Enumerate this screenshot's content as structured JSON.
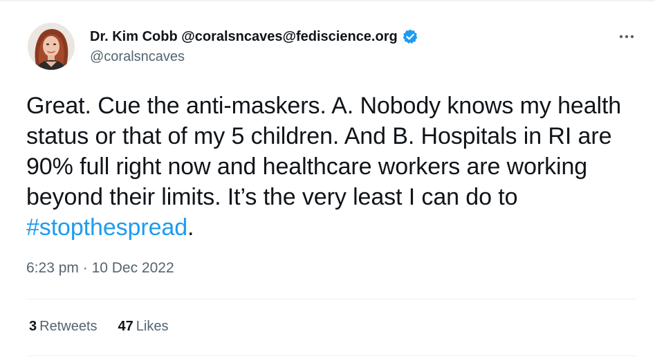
{
  "author": {
    "display_name": "Dr. Kim Cobb @coralsncaves@fediscience.org",
    "handle": "@coralsncaves",
    "verified_icon": "verified-badge-icon",
    "verified_color": "#1d9bf0"
  },
  "tweet": {
    "text_before_hashtag": "Great. Cue the anti-maskers. A. Nobody knows my health status or that of my 5 children. And B. Hospitals in RI are 90% full right now and healthcare workers are working beyond their limits. It’s the very least I can do to ",
    "hashtag": "#stopthespread",
    "text_after_hashtag": "."
  },
  "meta": {
    "time": "6:23 pm",
    "separator": " · ",
    "date": "10 Dec 2022"
  },
  "stats": {
    "retweets_count": "3",
    "retweets_label": "Retweets",
    "likes_count": "47",
    "likes_label": "Likes"
  },
  "more_icon": "more-horizontal-icon",
  "colors": {
    "link": "#1d9bf0",
    "secondary_text": "#536471",
    "primary_text": "#0f1419",
    "divider": "#eff3f4"
  }
}
